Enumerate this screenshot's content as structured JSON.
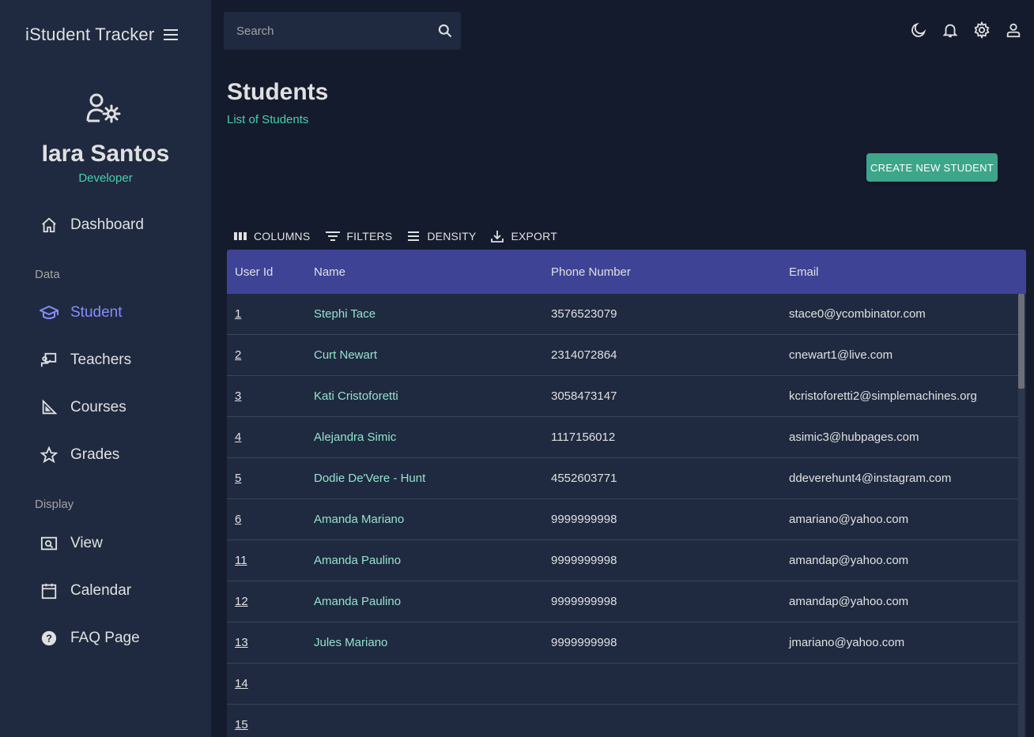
{
  "app": {
    "title": "iStudent Tracker"
  },
  "profile": {
    "name": "Iara Santos",
    "role": "Developer"
  },
  "nav": {
    "dashboard": "Dashboard",
    "section_data": "Data",
    "student": "Student",
    "teachers": "Teachers",
    "courses": "Courses",
    "grades": "Grades",
    "section_display": "Display",
    "view": "View",
    "calendar": "Calendar",
    "faq": "FAQ Page"
  },
  "search": {
    "placeholder": "Search"
  },
  "header": {
    "title": "Students",
    "subtitle": "List of Students"
  },
  "actions": {
    "create": "CREATE NEW STUDENT"
  },
  "toolbar": {
    "columns": "COLUMNS",
    "filters": "FILTERS",
    "density": "DENSITY",
    "export": "EXPORT"
  },
  "table": {
    "headers": {
      "id": "User Id",
      "name": "Name",
      "phone": "Phone Number",
      "email": "Email"
    },
    "rows": [
      {
        "id": "1",
        "name": "Stephi Tace",
        "phone": "3576523079",
        "email": "stace0@ycombinator.com"
      },
      {
        "id": "2",
        "name": "Curt Newart",
        "phone": "2314072864",
        "email": "cnewart1@live.com"
      },
      {
        "id": "3",
        "name": "Kati Cristoforetti",
        "phone": "3058473147",
        "email": "kcristoforetti2@simplemachines.org"
      },
      {
        "id": "4",
        "name": "Alejandra Simic",
        "phone": "1117156012",
        "email": "asimic3@hubpages.com"
      },
      {
        "id": "5",
        "name": "Dodie De'Vere - Hunt",
        "phone": "4552603771",
        "email": "ddeverehunt4@instagram.com"
      },
      {
        "id": "6",
        "name": "Amanda Mariano",
        "phone": "9999999998",
        "email": "amariano@yahoo.com"
      },
      {
        "id": "11",
        "name": "Amanda Paulino",
        "phone": "9999999998",
        "email": "amandap@yahoo.com"
      },
      {
        "id": "12",
        "name": "Amanda Paulino",
        "phone": "9999999998",
        "email": "amandap@yahoo.com"
      },
      {
        "id": "13",
        "name": "Jules Mariano",
        "phone": "9999999998",
        "email": "jmariano@yahoo.com"
      },
      {
        "id": "14",
        "name": "",
        "phone": "",
        "email": ""
      },
      {
        "id": "15",
        "name": "",
        "phone": "",
        "email": ""
      }
    ]
  },
  "colors": {
    "background": "#141b2d",
    "sidebar": "#1f2a40",
    "accent_green": "#4cceac",
    "active_nav": "#868dfb",
    "table_header": "#3e4396",
    "button": "#3da58a"
  },
  "icons": {
    "menu": "hamburger-icon",
    "profile": "user-gear-icon",
    "search": "search-icon",
    "topbar": [
      "moon-icon",
      "bell-icon",
      "gear-icon",
      "person-icon"
    ],
    "nav": [
      "home-icon",
      "school-icon",
      "teacher-board-icon",
      "triangle-ruler-icon",
      "star-icon",
      "search-window-icon",
      "calendar-icon",
      "help-circle-icon"
    ],
    "toolbar": [
      "columns-icon",
      "filter-icon",
      "density-icon",
      "download-icon"
    ]
  }
}
